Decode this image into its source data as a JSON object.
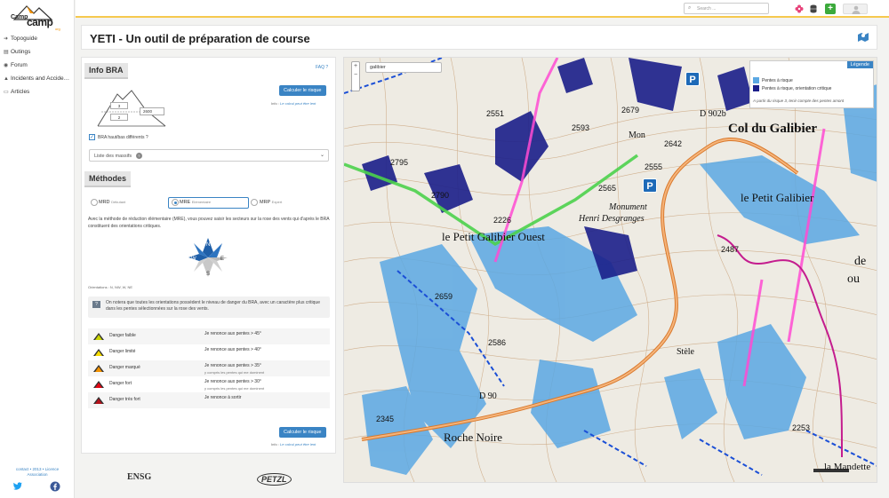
{
  "brand": {
    "line1": "Camp",
    "line2": "camp",
    "suffix": "org"
  },
  "sidebar": {
    "items": [
      {
        "icon": "arrow-icon",
        "glyph": "➜",
        "label": "Topoguide"
      },
      {
        "icon": "book-icon",
        "glyph": "▤",
        "label": "Outings"
      },
      {
        "icon": "forum-icon",
        "glyph": "◉",
        "label": "Forum"
      },
      {
        "icon": "warning-icon",
        "glyph": "▲",
        "label": "Incidents and Accide…"
      },
      {
        "icon": "article-icon",
        "glyph": "▭",
        "label": "Articles"
      }
    ],
    "footer_line1": "contact • 2013 • Licence",
    "footer_line2": "Association"
  },
  "topbar": {
    "search_placeholder": "Search ..."
  },
  "header": {
    "title": "YETI - Un outil de préparation de course"
  },
  "info_bra": {
    "title": "Info BRA",
    "faq": "FAQ ?",
    "upper_level": "3",
    "lower_level": "2",
    "altitude": "2600",
    "calc_button": "Calculer le risque",
    "calc_note_prefix": "Info :",
    "calc_note_link": "Le calcul peut être lent",
    "checkbox_label": "BRA haut/bas différents ?",
    "massif_select": "Liste des massifs"
  },
  "methods": {
    "title": "Méthodes",
    "options": [
      {
        "name": "MRD",
        "sub": "Débutant"
      },
      {
        "name": "MRE",
        "sub": "Elémentaire"
      },
      {
        "name": "MRP",
        "sub": "Expert"
      }
    ],
    "description": "Avec la méthode de réduction élémentaire (MRE), vous pouvez saisir les secteurs sur la rose des vents qui d'après le BRA constituent des orientations critiques.",
    "compass": {
      "n": "N",
      "e": "E",
      "s": "S",
      "w": "W"
    },
    "orientations": "Orientations : N, NW, W, NE",
    "info": "On notera que toutes les orientations possèdent le niveau de danger du BRA, avec un caractère plus critique dans les pentes sélectionnées sur la rose des vents.",
    "danger_rows": [
      {
        "color": "#c8d400",
        "name": "Danger faible",
        "rule": "Je renonce aux pentes > 45°",
        "sub": ""
      },
      {
        "color": "#f7dc00",
        "name": "Danger limité",
        "rule": "Je renonce aux pentes > 40°",
        "sub": ""
      },
      {
        "color": "#f39200",
        "name": "Danger marqué",
        "rule": "Je renonce aux pentes > 35°",
        "sub": "y compris les pentes qui me dominent"
      },
      {
        "color": "#e30613",
        "name": "Danger fort",
        "rule": "Je renonce aux pentes > 30°",
        "sub": "y compris les pentes qui me dominent"
      },
      {
        "color": "#b5121b",
        "name": "Danger très fort",
        "rule": "Je renonce à sortir",
        "sub": ""
      }
    ],
    "calc_button": "Calculer le risque",
    "calc_note_prefix": "Info :",
    "calc_note_link": "Le calcul peut être lent"
  },
  "partners": [
    "ENSG",
    "PETZL"
  ],
  "map": {
    "search_value": "galibier",
    "zoom_in": "+",
    "zoom_out": "−",
    "legend": {
      "header": "Légende",
      "items": [
        {
          "color": "#5ba8e3",
          "label": "Pentes à risque"
        },
        {
          "color": "#1b1f8a",
          "label": "Pentes à risque, orientation critique"
        }
      ],
      "footnote": "A partir du risque 3, tenir compte des pentes amont"
    },
    "labels": {
      "col": "Col du Galibier",
      "petit": "le Petit Galibier",
      "ouest": "le Petit Galibier Ouest",
      "monument": "Monument",
      "henri": "Henri Desgranges",
      "roche": "Roche Noire",
      "mandette": "la Mandette",
      "stele": "Stèle",
      "de": "de",
      "ou": "ou",
      "road": "D 902b",
      "road2": "D 90",
      "mon": "Mon",
      "parking": "P"
    },
    "elevations": [
      "2551",
      "2679",
      "2593",
      "2642",
      "2795",
      "2555",
      "2565",
      "2790",
      "2487",
      "2659",
      "2586",
      "2345",
      "2253",
      "2226"
    ]
  }
}
